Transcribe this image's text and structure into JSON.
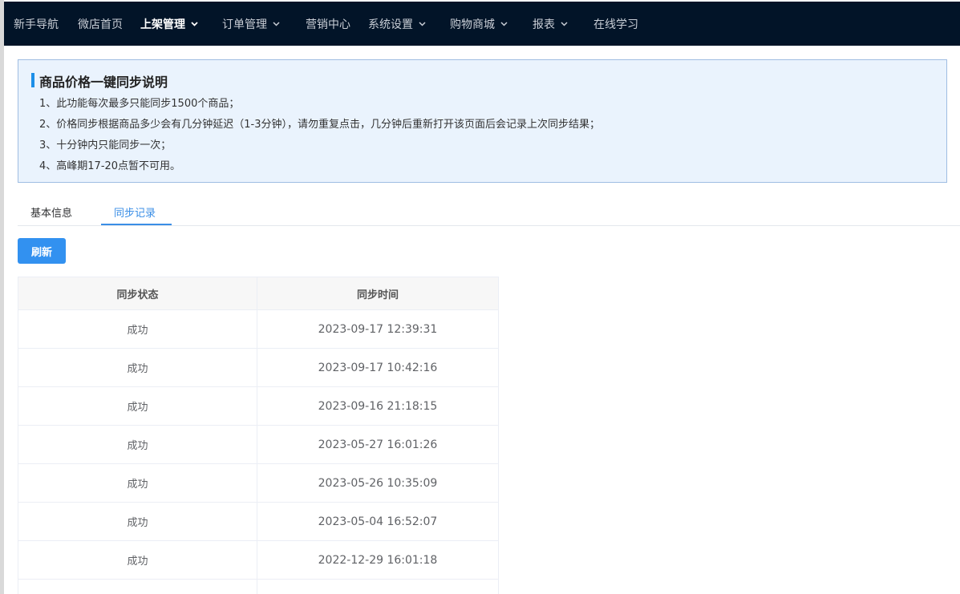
{
  "nav": {
    "items": [
      {
        "label": "新手导航",
        "dropdown": false,
        "active": false
      },
      {
        "label": "微店首页",
        "dropdown": false,
        "active": false
      },
      {
        "label": "上架管理",
        "dropdown": true,
        "active": true
      },
      {
        "label": "订单管理",
        "dropdown": true,
        "active": false
      },
      {
        "label": "营销中心",
        "dropdown": false,
        "active": false
      },
      {
        "label": "系统设置",
        "dropdown": true,
        "active": false
      },
      {
        "label": "购物商城",
        "dropdown": true,
        "active": false
      },
      {
        "label": "报表",
        "dropdown": true,
        "active": false
      },
      {
        "label": "在线学习",
        "dropdown": false,
        "active": false
      }
    ],
    "background": "#021428"
  },
  "notice": {
    "title": "商品价格一键同步说明",
    "lines": [
      "1、此功能每次最多只能同步1500个商品；",
      "2、价格同步根据商品多少会有几分钟延迟（1-3分钟），请勿重复点击，几分钟后重新打开该页面后会记录上次同步结果；",
      "3、十分钟内只能同步一次；",
      "4、高峰期17-20点暂不可用。"
    ]
  },
  "tabs": [
    {
      "label": "基本信息",
      "active": false
    },
    {
      "label": "同步记录",
      "active": true
    }
  ],
  "actions": {
    "refresh_label": "刷新"
  },
  "table": {
    "headers": [
      "同步状态",
      "同步时间"
    ],
    "rows": [
      [
        "成功",
        "2023-09-17 12:39:31"
      ],
      [
        "成功",
        "2023-09-17 10:42:16"
      ],
      [
        "成功",
        "2023-09-16 21:18:15"
      ],
      [
        "成功",
        "2023-05-27 16:01:26"
      ],
      [
        "成功",
        "2023-05-26 10:35:09"
      ],
      [
        "成功",
        "2023-05-04 16:52:07"
      ],
      [
        "成功",
        "2022-12-29 16:01:18"
      ]
    ]
  },
  "colors": {
    "accent": "#3291f0",
    "tab_active": "#3a8ee6",
    "notice_bg": "#eaf3fd"
  }
}
